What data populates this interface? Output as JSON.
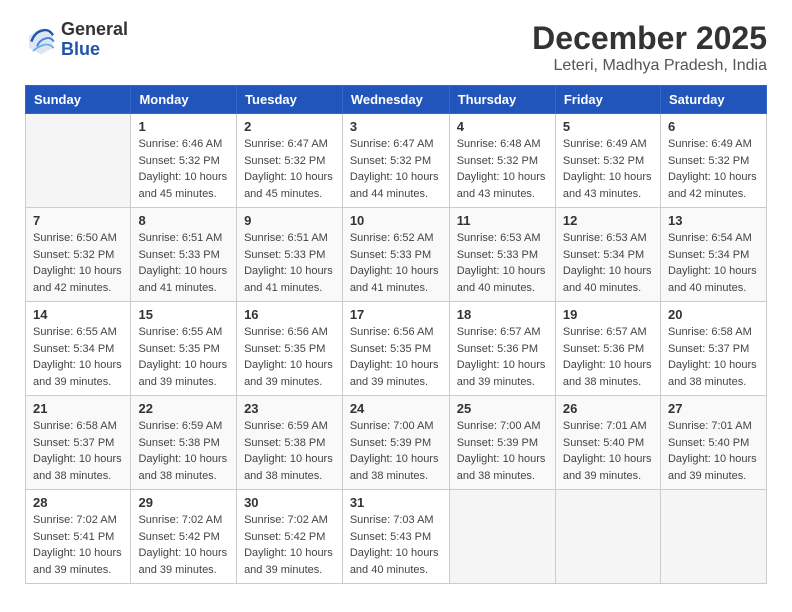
{
  "header": {
    "logo_line1": "General",
    "logo_line2": "Blue",
    "month_year": "December 2025",
    "location": "Leteri, Madhya Pradesh, India"
  },
  "weekdays": [
    "Sunday",
    "Monday",
    "Tuesday",
    "Wednesday",
    "Thursday",
    "Friday",
    "Saturday"
  ],
  "weeks": [
    [
      {
        "day": "",
        "info": ""
      },
      {
        "day": "1",
        "info": "Sunrise: 6:46 AM\nSunset: 5:32 PM\nDaylight: 10 hours\nand 45 minutes."
      },
      {
        "day": "2",
        "info": "Sunrise: 6:47 AM\nSunset: 5:32 PM\nDaylight: 10 hours\nand 45 minutes."
      },
      {
        "day": "3",
        "info": "Sunrise: 6:47 AM\nSunset: 5:32 PM\nDaylight: 10 hours\nand 44 minutes."
      },
      {
        "day": "4",
        "info": "Sunrise: 6:48 AM\nSunset: 5:32 PM\nDaylight: 10 hours\nand 43 minutes."
      },
      {
        "day": "5",
        "info": "Sunrise: 6:49 AM\nSunset: 5:32 PM\nDaylight: 10 hours\nand 43 minutes."
      },
      {
        "day": "6",
        "info": "Sunrise: 6:49 AM\nSunset: 5:32 PM\nDaylight: 10 hours\nand 42 minutes."
      }
    ],
    [
      {
        "day": "7",
        "info": "Sunrise: 6:50 AM\nSunset: 5:32 PM\nDaylight: 10 hours\nand 42 minutes."
      },
      {
        "day": "8",
        "info": "Sunrise: 6:51 AM\nSunset: 5:33 PM\nDaylight: 10 hours\nand 41 minutes."
      },
      {
        "day": "9",
        "info": "Sunrise: 6:51 AM\nSunset: 5:33 PM\nDaylight: 10 hours\nand 41 minutes."
      },
      {
        "day": "10",
        "info": "Sunrise: 6:52 AM\nSunset: 5:33 PM\nDaylight: 10 hours\nand 41 minutes."
      },
      {
        "day": "11",
        "info": "Sunrise: 6:53 AM\nSunset: 5:33 PM\nDaylight: 10 hours\nand 40 minutes."
      },
      {
        "day": "12",
        "info": "Sunrise: 6:53 AM\nSunset: 5:34 PM\nDaylight: 10 hours\nand 40 minutes."
      },
      {
        "day": "13",
        "info": "Sunrise: 6:54 AM\nSunset: 5:34 PM\nDaylight: 10 hours\nand 40 minutes."
      }
    ],
    [
      {
        "day": "14",
        "info": "Sunrise: 6:55 AM\nSunset: 5:34 PM\nDaylight: 10 hours\nand 39 minutes."
      },
      {
        "day": "15",
        "info": "Sunrise: 6:55 AM\nSunset: 5:35 PM\nDaylight: 10 hours\nand 39 minutes."
      },
      {
        "day": "16",
        "info": "Sunrise: 6:56 AM\nSunset: 5:35 PM\nDaylight: 10 hours\nand 39 minutes."
      },
      {
        "day": "17",
        "info": "Sunrise: 6:56 AM\nSunset: 5:35 PM\nDaylight: 10 hours\nand 39 minutes."
      },
      {
        "day": "18",
        "info": "Sunrise: 6:57 AM\nSunset: 5:36 PM\nDaylight: 10 hours\nand 39 minutes."
      },
      {
        "day": "19",
        "info": "Sunrise: 6:57 AM\nSunset: 5:36 PM\nDaylight: 10 hours\nand 38 minutes."
      },
      {
        "day": "20",
        "info": "Sunrise: 6:58 AM\nSunset: 5:37 PM\nDaylight: 10 hours\nand 38 minutes."
      }
    ],
    [
      {
        "day": "21",
        "info": "Sunrise: 6:58 AM\nSunset: 5:37 PM\nDaylight: 10 hours\nand 38 minutes."
      },
      {
        "day": "22",
        "info": "Sunrise: 6:59 AM\nSunset: 5:38 PM\nDaylight: 10 hours\nand 38 minutes."
      },
      {
        "day": "23",
        "info": "Sunrise: 6:59 AM\nSunset: 5:38 PM\nDaylight: 10 hours\nand 38 minutes."
      },
      {
        "day": "24",
        "info": "Sunrise: 7:00 AM\nSunset: 5:39 PM\nDaylight: 10 hours\nand 38 minutes."
      },
      {
        "day": "25",
        "info": "Sunrise: 7:00 AM\nSunset: 5:39 PM\nDaylight: 10 hours\nand 38 minutes."
      },
      {
        "day": "26",
        "info": "Sunrise: 7:01 AM\nSunset: 5:40 PM\nDaylight: 10 hours\nand 39 minutes."
      },
      {
        "day": "27",
        "info": "Sunrise: 7:01 AM\nSunset: 5:40 PM\nDaylight: 10 hours\nand 39 minutes."
      }
    ],
    [
      {
        "day": "28",
        "info": "Sunrise: 7:02 AM\nSunset: 5:41 PM\nDaylight: 10 hours\nand 39 minutes."
      },
      {
        "day": "29",
        "info": "Sunrise: 7:02 AM\nSunset: 5:42 PM\nDaylight: 10 hours\nand 39 minutes."
      },
      {
        "day": "30",
        "info": "Sunrise: 7:02 AM\nSunset: 5:42 PM\nDaylight: 10 hours\nand 39 minutes."
      },
      {
        "day": "31",
        "info": "Sunrise: 7:03 AM\nSunset: 5:43 PM\nDaylight: 10 hours\nand 40 minutes."
      },
      {
        "day": "",
        "info": ""
      },
      {
        "day": "",
        "info": ""
      },
      {
        "day": "",
        "info": ""
      }
    ]
  ]
}
